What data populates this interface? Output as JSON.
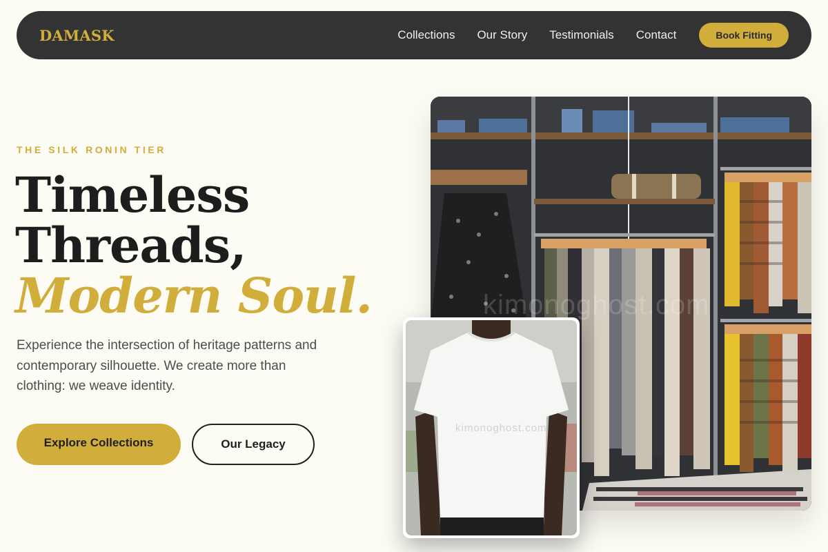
{
  "nav": {
    "brand": "DAMASK",
    "links": [
      "Collections",
      "Our Story",
      "Testimonials",
      "Contact"
    ],
    "cta": "Book Fitting"
  },
  "hero": {
    "eyebrow": "THE SILK RONIN TIER",
    "headline_line1": "Timeless",
    "headline_line2": "Threads,",
    "headline_accent": "Modern Soul.",
    "lede": "Experience the intersection of heritage patterns and contemporary silhouette. We create more than clothing: we weave identity.",
    "primary_button": "Explore Collections",
    "secondary_button": "Our Legacy"
  },
  "images": {
    "main_watermark": "kimonoghost.com",
    "small_watermark": "kimonoghost.com"
  },
  "colors": {
    "accent": "#d1ad3c",
    "nav_bg": "#333333",
    "page_bg": "#fcfbf4",
    "text": "#1f1f1f"
  }
}
